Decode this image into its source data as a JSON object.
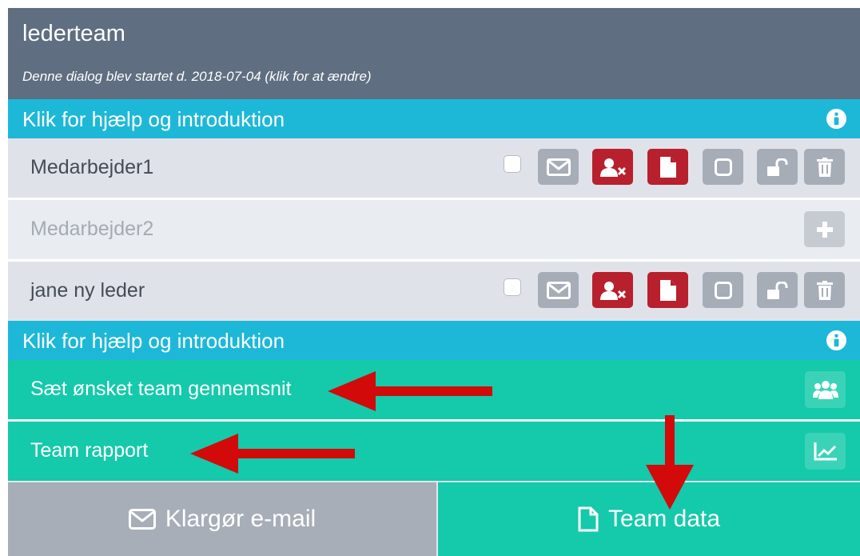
{
  "header": {
    "title": "lederteam",
    "subtitle": "Denne dialog blev startet d. 2018-07-04 (klik for at ændre)"
  },
  "help": {
    "label": "Klik for hjælp og introduktion"
  },
  "members": [
    {
      "name": "Medarbejder1",
      "active": true
    },
    {
      "name": "Medarbejder2",
      "active": false
    },
    {
      "name": "jane ny leder",
      "active": true
    }
  ],
  "team_actions": {
    "average_label": "Sæt ønsket team gennemsnit",
    "report_label": "Team rapport"
  },
  "footer": {
    "email_label": "Klargør e-mail",
    "data_label": "Team data"
  },
  "colors": {
    "header": "#5f6e80",
    "help_bar": "#1db8d8",
    "teal": "#15c9ab",
    "danger": "#b8202d",
    "neutral_button": "#a6adb7",
    "annotation_arrow": "#d20a0a"
  },
  "icons": {
    "row_actions": [
      "checkbox",
      "envelope-icon",
      "remove-user-icon",
      "document-icon",
      "square-icon",
      "unlock-icon",
      "trash-icon"
    ],
    "add": "plus-icon",
    "average": "users-icon",
    "report": "line-chart-icon",
    "info": "info-icon"
  }
}
